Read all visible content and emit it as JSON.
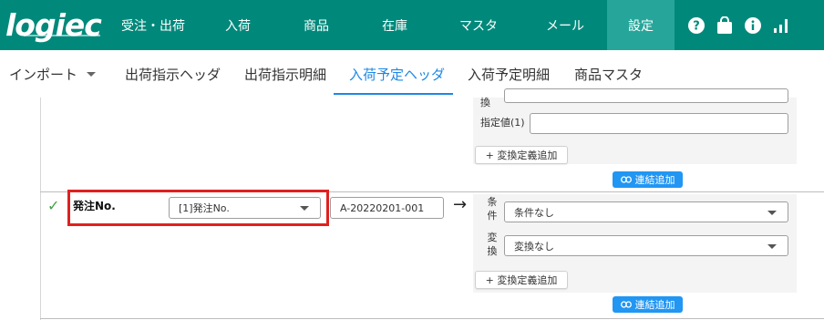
{
  "app": {
    "logo_text": "logiec"
  },
  "nav": {
    "items": [
      {
        "label": "受注・出荷"
      },
      {
        "label": "入荷"
      },
      {
        "label": "商品"
      },
      {
        "label": "在庫"
      },
      {
        "label": "マスタ"
      },
      {
        "label": "メール"
      },
      {
        "label": "設定"
      }
    ],
    "icons": [
      "help-icon",
      "shopping-bag-icon",
      "info-icon",
      "bar-chart-icon"
    ]
  },
  "subtabs": {
    "import_label": "インポート",
    "items": [
      {
        "label": "出荷指示ヘッダ"
      },
      {
        "label": "出荷指示明細"
      },
      {
        "label": "入荷予定ヘッダ"
      },
      {
        "label": "入荷予定明細"
      },
      {
        "label": "商品マスタ"
      }
    ]
  },
  "upper_panel": {
    "conversion_label_fragment": "換",
    "specified_value_label": "指定値(1)",
    "specified_value": "",
    "add_conversion_label": "+ 変換定義追加",
    "add_link_label": "連結追加"
  },
  "row": {
    "field_name": "発注No.",
    "mapping_select": "[1]発注No.",
    "sample_value": "A-20220201-001",
    "condition_label": "条件",
    "condition_value": "条件なし",
    "conversion_label": "変換",
    "conversion_value": "変換なし",
    "add_conversion_label": "+ 変換定義追加",
    "add_link_label": "連結追加"
  },
  "colors": {
    "brand": "#00897b",
    "nav_active": "#26a69a",
    "tab_active": "#1e88e5",
    "link_button": "#2196f3",
    "check": "#43a047",
    "highlight": "#e02020"
  }
}
